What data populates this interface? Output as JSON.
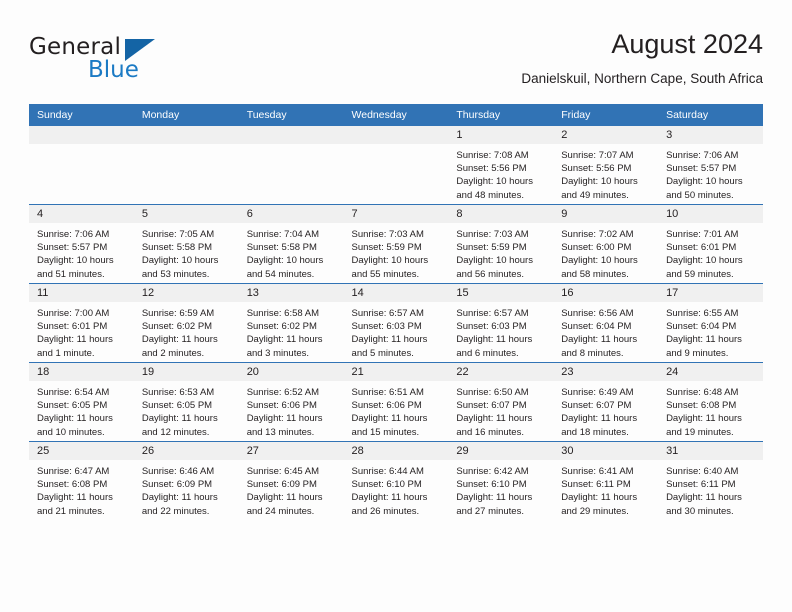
{
  "brand": {
    "name_top": "General",
    "name_bottom": "Blue",
    "accent_color": "#1b7ac4",
    "triangle_color": "#1464a5"
  },
  "header": {
    "title": "August 2024",
    "subtitle": "Danielskuil, Northern Cape, South Africa"
  },
  "theme": {
    "header_blue": "#3173b5",
    "daynum_band": "#f0f0f0",
    "page_background": "#fdfdfd",
    "text": "#231f20"
  },
  "calendar": {
    "weekday_headers": [
      "Sunday",
      "Monday",
      "Tuesday",
      "Wednesday",
      "Thursday",
      "Friday",
      "Saturday"
    ],
    "weeks": [
      [
        {
          "day": "",
          "blank": true,
          "sunrise": "",
          "sunset": "",
          "daylight1": "",
          "daylight2": ""
        },
        {
          "day": "",
          "blank": true,
          "sunrise": "",
          "sunset": "",
          "daylight1": "",
          "daylight2": ""
        },
        {
          "day": "",
          "blank": true,
          "sunrise": "",
          "sunset": "",
          "daylight1": "",
          "daylight2": ""
        },
        {
          "day": "",
          "blank": true,
          "sunrise": "",
          "sunset": "",
          "daylight1": "",
          "daylight2": ""
        },
        {
          "day": "1",
          "blank": false,
          "sunrise": "Sunrise: 7:08 AM",
          "sunset": "Sunset: 5:56 PM",
          "daylight1": "Daylight: 10 hours",
          "daylight2": "and 48 minutes."
        },
        {
          "day": "2",
          "blank": false,
          "sunrise": "Sunrise: 7:07 AM",
          "sunset": "Sunset: 5:56 PM",
          "daylight1": "Daylight: 10 hours",
          "daylight2": "and 49 minutes."
        },
        {
          "day": "3",
          "blank": false,
          "sunrise": "Sunrise: 7:06 AM",
          "sunset": "Sunset: 5:57 PM",
          "daylight1": "Daylight: 10 hours",
          "daylight2": "and 50 minutes."
        }
      ],
      [
        {
          "day": "4",
          "blank": false,
          "sunrise": "Sunrise: 7:06 AM",
          "sunset": "Sunset: 5:57 PM",
          "daylight1": "Daylight: 10 hours",
          "daylight2": "and 51 minutes."
        },
        {
          "day": "5",
          "blank": false,
          "sunrise": "Sunrise: 7:05 AM",
          "sunset": "Sunset: 5:58 PM",
          "daylight1": "Daylight: 10 hours",
          "daylight2": "and 53 minutes."
        },
        {
          "day": "6",
          "blank": false,
          "sunrise": "Sunrise: 7:04 AM",
          "sunset": "Sunset: 5:58 PM",
          "daylight1": "Daylight: 10 hours",
          "daylight2": "and 54 minutes."
        },
        {
          "day": "7",
          "blank": false,
          "sunrise": "Sunrise: 7:03 AM",
          "sunset": "Sunset: 5:59 PM",
          "daylight1": "Daylight: 10 hours",
          "daylight2": "and 55 minutes."
        },
        {
          "day": "8",
          "blank": false,
          "sunrise": "Sunrise: 7:03 AM",
          "sunset": "Sunset: 5:59 PM",
          "daylight1": "Daylight: 10 hours",
          "daylight2": "and 56 minutes."
        },
        {
          "day": "9",
          "blank": false,
          "sunrise": "Sunrise: 7:02 AM",
          "sunset": "Sunset: 6:00 PM",
          "daylight1": "Daylight: 10 hours",
          "daylight2": "and 58 minutes."
        },
        {
          "day": "10",
          "blank": false,
          "sunrise": "Sunrise: 7:01 AM",
          "sunset": "Sunset: 6:01 PM",
          "daylight1": "Daylight: 10 hours",
          "daylight2": "and 59 minutes."
        }
      ],
      [
        {
          "day": "11",
          "blank": false,
          "sunrise": "Sunrise: 7:00 AM",
          "sunset": "Sunset: 6:01 PM",
          "daylight1": "Daylight: 11 hours",
          "daylight2": "and 1 minute."
        },
        {
          "day": "12",
          "blank": false,
          "sunrise": "Sunrise: 6:59 AM",
          "sunset": "Sunset: 6:02 PM",
          "daylight1": "Daylight: 11 hours",
          "daylight2": "and 2 minutes."
        },
        {
          "day": "13",
          "blank": false,
          "sunrise": "Sunrise: 6:58 AM",
          "sunset": "Sunset: 6:02 PM",
          "daylight1": "Daylight: 11 hours",
          "daylight2": "and 3 minutes."
        },
        {
          "day": "14",
          "blank": false,
          "sunrise": "Sunrise: 6:57 AM",
          "sunset": "Sunset: 6:03 PM",
          "daylight1": "Daylight: 11 hours",
          "daylight2": "and 5 minutes."
        },
        {
          "day": "15",
          "blank": false,
          "sunrise": "Sunrise: 6:57 AM",
          "sunset": "Sunset: 6:03 PM",
          "daylight1": "Daylight: 11 hours",
          "daylight2": "and 6 minutes."
        },
        {
          "day": "16",
          "blank": false,
          "sunrise": "Sunrise: 6:56 AM",
          "sunset": "Sunset: 6:04 PM",
          "daylight1": "Daylight: 11 hours",
          "daylight2": "and 8 minutes."
        },
        {
          "day": "17",
          "blank": false,
          "sunrise": "Sunrise: 6:55 AM",
          "sunset": "Sunset: 6:04 PM",
          "daylight1": "Daylight: 11 hours",
          "daylight2": "and 9 minutes."
        }
      ],
      [
        {
          "day": "18",
          "blank": false,
          "sunrise": "Sunrise: 6:54 AM",
          "sunset": "Sunset: 6:05 PM",
          "daylight1": "Daylight: 11 hours",
          "daylight2": "and 10 minutes."
        },
        {
          "day": "19",
          "blank": false,
          "sunrise": "Sunrise: 6:53 AM",
          "sunset": "Sunset: 6:05 PM",
          "daylight1": "Daylight: 11 hours",
          "daylight2": "and 12 minutes."
        },
        {
          "day": "20",
          "blank": false,
          "sunrise": "Sunrise: 6:52 AM",
          "sunset": "Sunset: 6:06 PM",
          "daylight1": "Daylight: 11 hours",
          "daylight2": "and 13 minutes."
        },
        {
          "day": "21",
          "blank": false,
          "sunrise": "Sunrise: 6:51 AM",
          "sunset": "Sunset: 6:06 PM",
          "daylight1": "Daylight: 11 hours",
          "daylight2": "and 15 minutes."
        },
        {
          "day": "22",
          "blank": false,
          "sunrise": "Sunrise: 6:50 AM",
          "sunset": "Sunset: 6:07 PM",
          "daylight1": "Daylight: 11 hours",
          "daylight2": "and 16 minutes."
        },
        {
          "day": "23",
          "blank": false,
          "sunrise": "Sunrise: 6:49 AM",
          "sunset": "Sunset: 6:07 PM",
          "daylight1": "Daylight: 11 hours",
          "daylight2": "and 18 minutes."
        },
        {
          "day": "24",
          "blank": false,
          "sunrise": "Sunrise: 6:48 AM",
          "sunset": "Sunset: 6:08 PM",
          "daylight1": "Daylight: 11 hours",
          "daylight2": "and 19 minutes."
        }
      ],
      [
        {
          "day": "25",
          "blank": false,
          "sunrise": "Sunrise: 6:47 AM",
          "sunset": "Sunset: 6:08 PM",
          "daylight1": "Daylight: 11 hours",
          "daylight2": "and 21 minutes."
        },
        {
          "day": "26",
          "blank": false,
          "sunrise": "Sunrise: 6:46 AM",
          "sunset": "Sunset: 6:09 PM",
          "daylight1": "Daylight: 11 hours",
          "daylight2": "and 22 minutes."
        },
        {
          "day": "27",
          "blank": false,
          "sunrise": "Sunrise: 6:45 AM",
          "sunset": "Sunset: 6:09 PM",
          "daylight1": "Daylight: 11 hours",
          "daylight2": "and 24 minutes."
        },
        {
          "day": "28",
          "blank": false,
          "sunrise": "Sunrise: 6:44 AM",
          "sunset": "Sunset: 6:10 PM",
          "daylight1": "Daylight: 11 hours",
          "daylight2": "and 26 minutes."
        },
        {
          "day": "29",
          "blank": false,
          "sunrise": "Sunrise: 6:42 AM",
          "sunset": "Sunset: 6:10 PM",
          "daylight1": "Daylight: 11 hours",
          "daylight2": "and 27 minutes."
        },
        {
          "day": "30",
          "blank": false,
          "sunrise": "Sunrise: 6:41 AM",
          "sunset": "Sunset: 6:11 PM",
          "daylight1": "Daylight: 11 hours",
          "daylight2": "and 29 minutes."
        },
        {
          "day": "31",
          "blank": false,
          "sunrise": "Sunrise: 6:40 AM",
          "sunset": "Sunset: 6:11 PM",
          "daylight1": "Daylight: 11 hours",
          "daylight2": "and 30 minutes."
        }
      ]
    ]
  }
}
